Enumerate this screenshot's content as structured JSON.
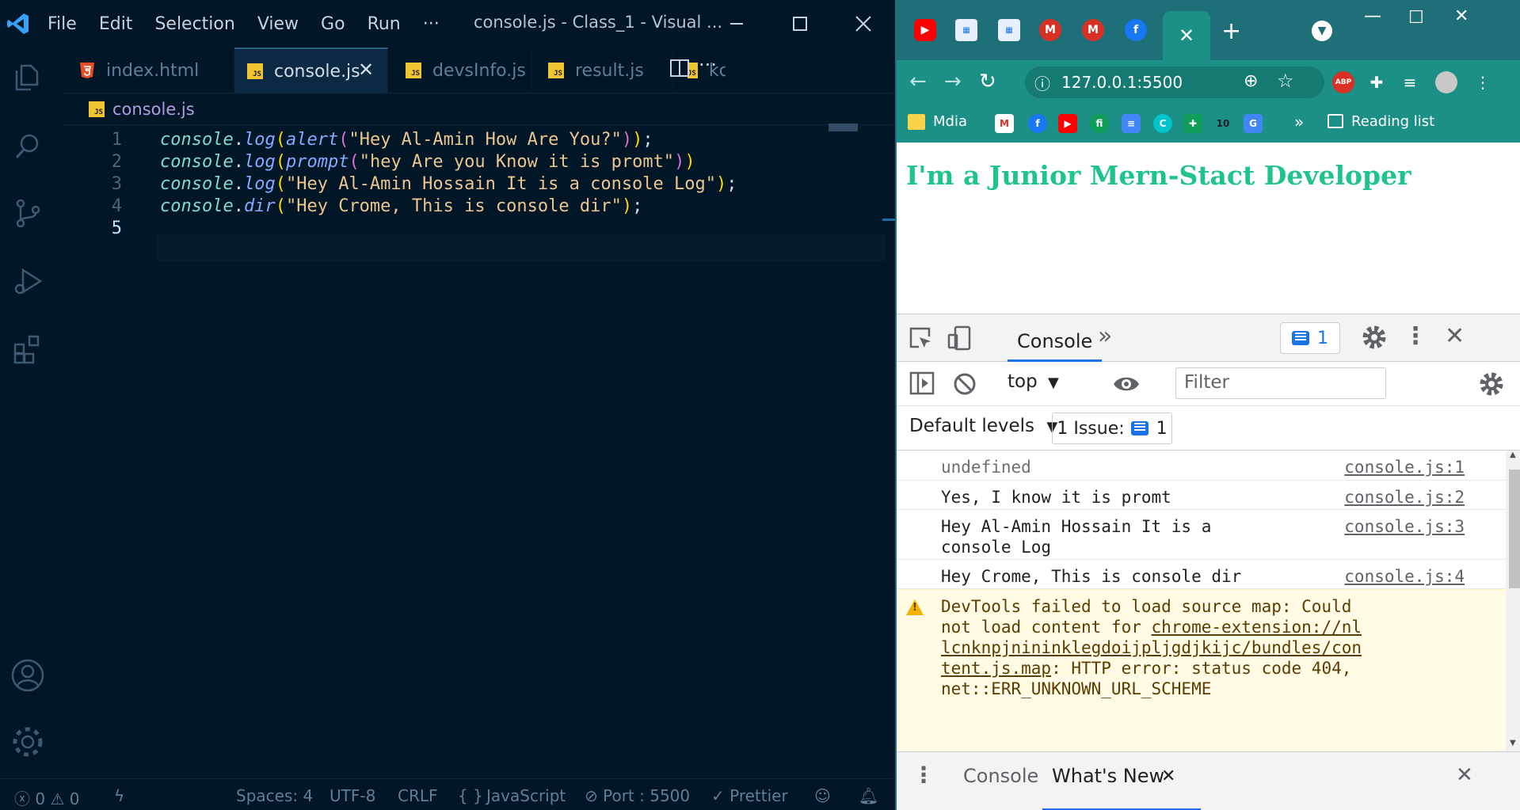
{
  "vscode": {
    "menus": [
      "File",
      "Edit",
      "Selection",
      "View",
      "Go",
      "Run",
      "···"
    ],
    "window_title": "console.js - Class_1 - Visual ...",
    "tabs": [
      {
        "label": "index.html",
        "icon": "html5-icon"
      },
      {
        "label": "console.js",
        "icon": "js-icon",
        "active": true
      },
      {
        "label": "devsInfo.js",
        "icon": "js-icon"
      },
      {
        "label": "result.js",
        "icon": "js-icon"
      },
      {
        "label": "kc",
        "icon": "js-icon"
      }
    ],
    "js_badge": "JS",
    "breadcrumb": "console.js",
    "code_lines": [
      {
        "n": "1",
        "obj": "console",
        "dot": ".",
        "fn": "log",
        "open": "(",
        "fn2": "alert",
        "open2": "(",
        "str": "\"Hey Al-Amin How Are You?\"",
        "close2": ")",
        "close": ")",
        "end": ";"
      },
      {
        "n": "2",
        "obj": "console",
        "dot": ".",
        "fn": "log",
        "open": "(",
        "fn2": "prompt",
        "open2": "(",
        "str": "\"hey Are you Know it is promt\"",
        "close2": ")",
        "close": ")",
        "end": ""
      },
      {
        "n": "3",
        "obj": "console",
        "dot": ".",
        "fn": "log",
        "open": "(",
        "str": "\"Hey Al-Amin Hossain It is a console Log\"",
        "close": ")",
        "end": ";"
      },
      {
        "n": "4",
        "obj": "console",
        "dot": ".",
        "fn": "dir",
        "open": "(",
        "str": "\"Hey Crome, This is console dir\"",
        "close": ")",
        "end": ";"
      },
      {
        "n": "5"
      }
    ],
    "status": {
      "errors": "0",
      "warnings": "0",
      "spaces": "Spaces: 4",
      "encoding": "UTF-8",
      "eol": "CRLF",
      "language_braces": "{ }",
      "language": "JavaScript",
      "port": "Port : 5500",
      "prettier": "Prettier"
    }
  },
  "chrome": {
    "url": "127.0.0.1:5500",
    "tab_close": "✕",
    "new_tab": "+",
    "bookmarks": {
      "folder": "Mdia",
      "more": "»",
      "reading_list": "Reading list"
    },
    "ext_abp": "ABP",
    "page_heading": "I'm a Junior Mern-Stact Developer",
    "devtools": {
      "console_tab": "Console",
      "more_tabs": "»",
      "issue_count": "1",
      "context": "top",
      "filter_placeholder": "Filter",
      "levels": "Default levels",
      "issues_label": "1 Issue:",
      "issues_count": "1",
      "messages": [
        {
          "text": "undefined",
          "source": "console.js:1",
          "muted": true
        },
        {
          "text": "Yes, I know it is promt",
          "source": "console.js:2"
        },
        {
          "text": "Hey Al-Amin Hossain It is a\nconsole Log",
          "source": "console.js:3"
        },
        {
          "text": "Hey Crome, This is console dir",
          "source": "console.js:4"
        }
      ],
      "warning": {
        "prefix": "DevTools failed to load source map: Could not load content for ",
        "link": "chrome-extension://nllcnknpjnininklegdoijpljgdjkijc/bundles/content.js.map",
        "suffix": ": HTTP error: status code 404, net::ERR_UNKNOWN_URL_SCHEME"
      },
      "drawer": {
        "console": "Console",
        "whats_new": "What's New"
      }
    }
  },
  "colors": {
    "vscode_bg": "#011627",
    "chrome_frame": "#1f6f78",
    "page_heading": "#1ec48a"
  }
}
